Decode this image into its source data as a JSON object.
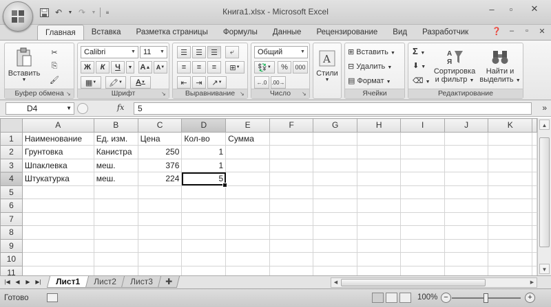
{
  "window": {
    "title": "Книга1.xlsx - Microsoft Excel"
  },
  "ribbon_tabs": [
    "Главная",
    "Вставка",
    "Разметка страницы",
    "Формулы",
    "Данные",
    "Рецензирование",
    "Вид",
    "Разработчик"
  ],
  "ribbon": {
    "clipboard": {
      "label": "Буфер обмена",
      "paste": "Вставить"
    },
    "font": {
      "label": "Шрифт",
      "name": "Calibri",
      "size": "11",
      "bold": "Ж",
      "italic": "К",
      "underline": "Ч"
    },
    "alignment": {
      "label": "Выравнивание"
    },
    "number": {
      "label": "Число",
      "format": "Общий",
      "percent": "%",
      "thousands": "000"
    },
    "styles": {
      "label": "Стили"
    },
    "cells": {
      "label": "Ячейки",
      "insert": "Вставить",
      "delete": "Удалить",
      "format": "Формат"
    },
    "editing": {
      "label": "Редактирование",
      "sort": "Сортировка",
      "sort2": "и фильтр",
      "find": "Найти и",
      "find2": "выделить"
    }
  },
  "formula_bar": {
    "name_box": "D4",
    "fx": "fx",
    "value": "5"
  },
  "columns": [
    "A",
    "B",
    "C",
    "D",
    "E",
    "F",
    "G",
    "H",
    "I",
    "J",
    "K"
  ],
  "rows": [
    [
      "Наименование",
      "Ед. изм.",
      "Цена",
      "Кол-во",
      "Сумма",
      "",
      "",
      "",
      "",
      "",
      ""
    ],
    [
      "Грунтовка",
      "Канистра",
      "250",
      "1",
      "",
      "",
      "",
      "",
      "",
      "",
      ""
    ],
    [
      "Шпаклевка",
      "меш.",
      "376",
      "1",
      "",
      "",
      "",
      "",
      "",
      "",
      ""
    ],
    [
      "Штукатурка",
      "меш.",
      "224",
      "5",
      "",
      "",
      "",
      "",
      "",
      "",
      ""
    ],
    [
      "",
      "",
      "",
      "",
      "",
      "",
      "",
      "",
      "",
      "",
      ""
    ],
    [
      "",
      "",
      "",
      "",
      "",
      "",
      "",
      "",
      "",
      "",
      ""
    ],
    [
      "",
      "",
      "",
      "",
      "",
      "",
      "",
      "",
      "",
      "",
      ""
    ],
    [
      "",
      "",
      "",
      "",
      "",
      "",
      "",
      "",
      "",
      "",
      ""
    ],
    [
      "",
      "",
      "",
      "",
      "",
      "",
      "",
      "",
      "",
      "",
      ""
    ],
    [
      "",
      "",
      "",
      "",
      "",
      "",
      "",
      "",
      "",
      "",
      ""
    ],
    [
      "",
      "",
      "",
      "",
      "",
      "",
      "",
      "",
      "",
      "",
      ""
    ]
  ],
  "active_cell": {
    "row": 4,
    "col": "D"
  },
  "sheets": [
    "Лист1",
    "Лист2",
    "Лист3"
  ],
  "active_sheet": "Лист1",
  "status": {
    "text": "Готово",
    "zoom": "100%"
  }
}
